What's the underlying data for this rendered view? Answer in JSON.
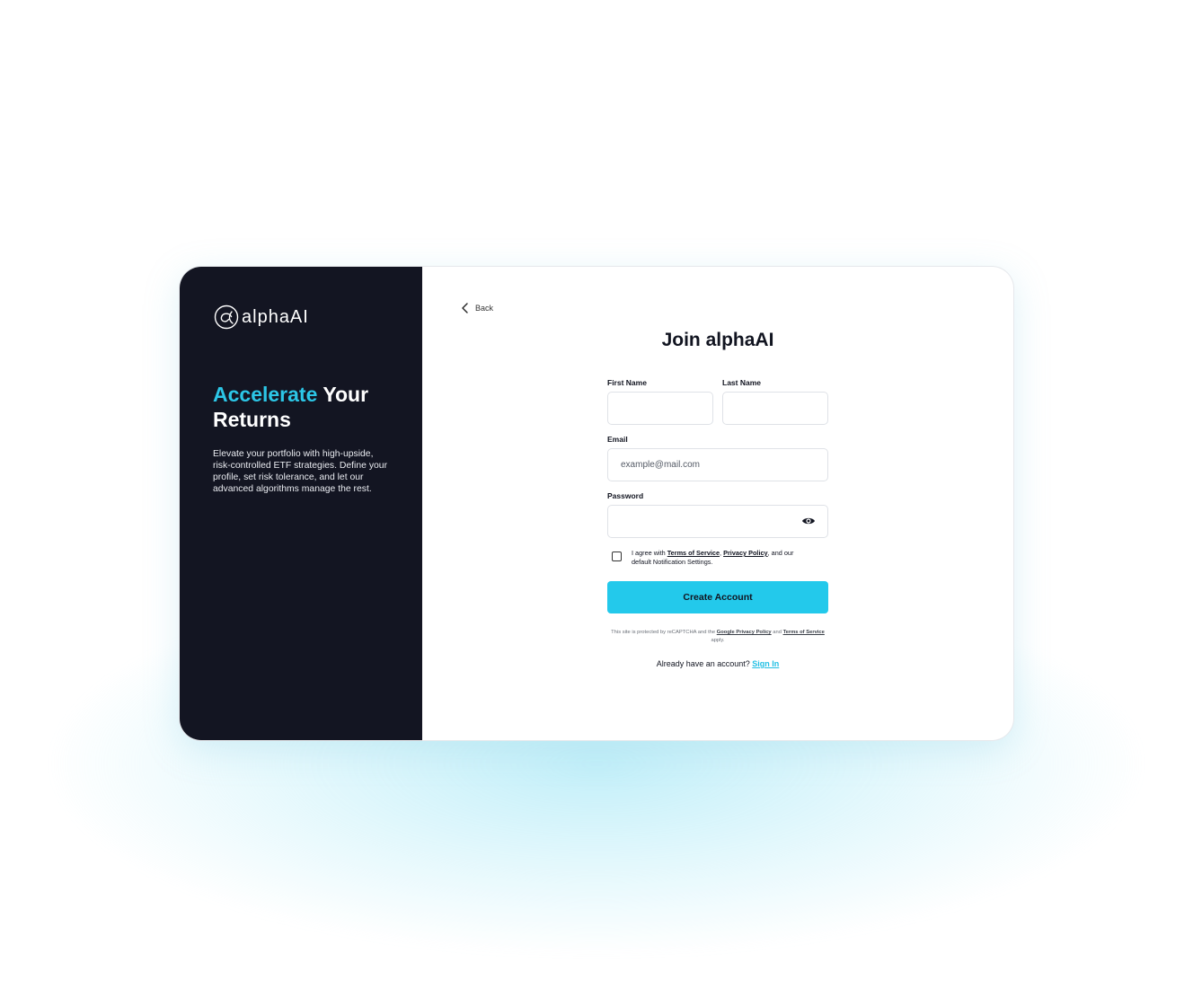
{
  "brand": {
    "name": "alphaAI"
  },
  "hero": {
    "headline_accent": "Accelerate",
    "headline_rest": " Your Returns",
    "description": "Elevate your portfolio with high-upside, risk-controlled ETF strategies. Define your profile, set risk tolerance, and let our advanced algorithms manage the rest."
  },
  "nav": {
    "back_label": "Back"
  },
  "form": {
    "title": "Join alphaAI",
    "first_name": {
      "label": "First Name",
      "value": "",
      "placeholder": ""
    },
    "last_name": {
      "label": "Last Name",
      "value": "",
      "placeholder": ""
    },
    "email": {
      "label": "Email",
      "value": "",
      "placeholder": "example@mail.com"
    },
    "password": {
      "label": "Password",
      "value": "",
      "placeholder": ""
    },
    "agreement": {
      "prefix": "I agree with ",
      "terms_link": "Terms of Service",
      "separator": ", ",
      "privacy_link": "Privacy Policy",
      "suffix": ", and our default Notification Settings.",
      "checked": false
    },
    "submit_label": "Create Account",
    "recaptcha": {
      "prefix": "This site is protected by reCAPTCHA and the ",
      "privacy_link": "Google Privacy Policy",
      "middle": " and ",
      "terms_link": "Terms of Service",
      "suffix": " apply."
    },
    "signin": {
      "prompt": "Already have an account? ",
      "link": "Sign In"
    }
  },
  "colors": {
    "accent": "#23c9eb",
    "panel_dark": "#131522",
    "headline_accent": "#2cc6e6"
  },
  "icons": {
    "back": "chevron-left-icon",
    "password_toggle": "eye-icon",
    "logo": "alpha-logo-icon"
  }
}
